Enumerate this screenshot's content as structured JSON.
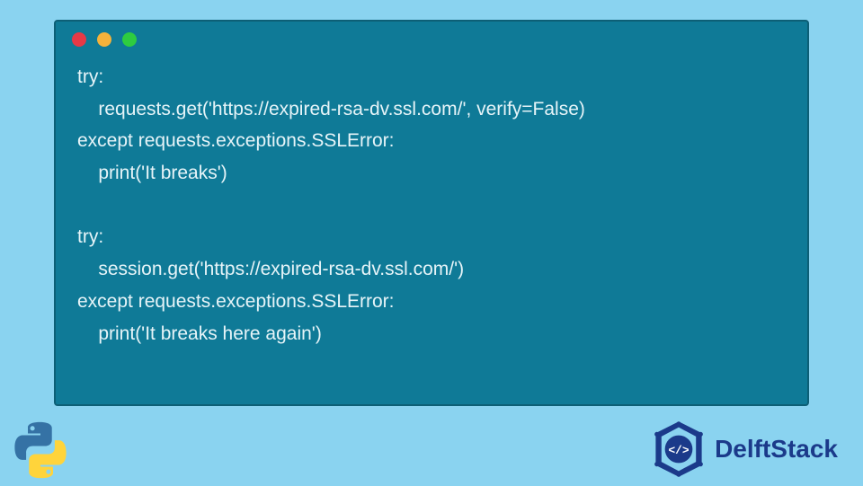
{
  "code_lines": [
    "try:",
    "    requests.get('https://expired-rsa-dv.ssl.com/', verify=False)",
    "except requests.exceptions.SSLError:",
    "    print('It breaks')",
    "",
    "try:",
    "    session.get('https://expired-rsa-dv.ssl.com/')",
    "except requests.exceptions.SSLError:",
    "    print('It breaks here again')"
  ],
  "branding": {
    "name": "DelftStack"
  },
  "window": {
    "dots": [
      "red",
      "yellow",
      "green"
    ]
  }
}
